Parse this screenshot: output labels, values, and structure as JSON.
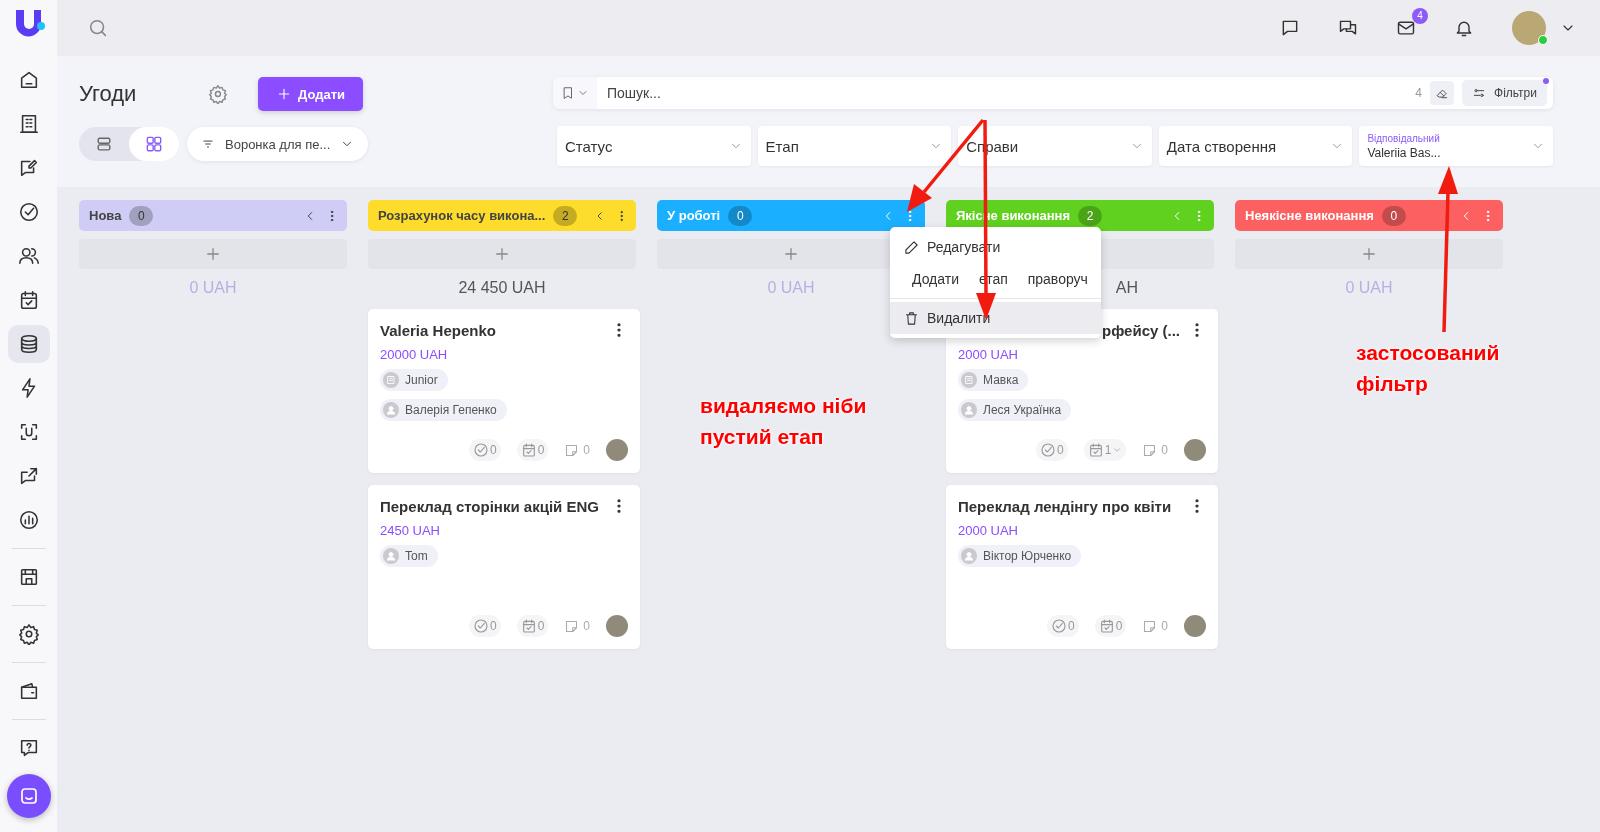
{
  "sidebar": {
    "nav_items": [
      {
        "selected": false
      },
      {
        "selected": false
      },
      {
        "selected": false
      },
      {
        "selected": false
      },
      {
        "selected": false
      },
      {
        "selected": false
      },
      {
        "selected": true
      },
      {
        "selected": false
      },
      {
        "selected": false
      },
      {
        "selected": false
      },
      {
        "selected": false
      },
      {
        "selected": false
      },
      {
        "selected": false
      },
      {
        "selected": false
      },
      {
        "selected": false
      }
    ]
  },
  "top_bar": {
    "mail_badge": "4",
    "avatar_online": true
  },
  "header": {
    "title": "Угоди",
    "add_button": "Додати",
    "view_toggle": [
      {
        "selected": false
      },
      {
        "selected": true
      }
    ],
    "funnel_select": "Воронка для пе...",
    "search": {
      "placeholder": "Пошук...",
      "count": "4"
    },
    "filters_button": "Фільтри",
    "filters_active": true,
    "filters": [
      {
        "kind": "empty",
        "label": "Статус"
      },
      {
        "kind": "empty",
        "label": "Етап"
      },
      {
        "kind": "empty",
        "label": "Справи"
      },
      {
        "kind": "empty",
        "label": "Дата створення"
      },
      {
        "kind": "applied",
        "label": "Відповідальний",
        "value": "Valeriia Bas..."
      }
    ]
  },
  "columns": [
    {
      "name": "Нова",
      "count": "0",
      "color": "#cfcdf5",
      "total": "0 UAH",
      "total_partly_hidden": false
    },
    {
      "name": "Розрахунок часу викона...",
      "count": "2",
      "color": "#fddc2c",
      "total": "24 450 UAH",
      "total_partly_hidden": false,
      "cards": [
        {
          "title": "Valeria Hepenko",
          "partly_hidden": false,
          "amount": "20000 UAH",
          "tags": [
            {
              "kind": "company",
              "text": "Junior"
            },
            {
              "kind": "person",
              "text": "Валерія Гепенко"
            }
          ],
          "tasks": "0",
          "events": "0",
          "events_caret": false,
          "notes": "0"
        },
        {
          "title": "Переклад сторінки акцій ENG",
          "partly_hidden": false,
          "amount": "2450 UAH",
          "tags": [
            {
              "kind": "person",
              "text": "Tom"
            }
          ],
          "tasks": "0",
          "events": "0",
          "events_caret": false,
          "notes": "0"
        }
      ]
    },
    {
      "name": "У роботі",
      "count": "0",
      "color": "#1ab0ff",
      "total": "0 UAH",
      "total_partly_hidden": false
    },
    {
      "name": "Якісне виконання",
      "count": "2",
      "color": "#61d11f",
      "total": "AH",
      "total_partly_hidden": true,
      "cards": [
        {
          "title": "рфейсу (...",
          "partly_hidden": true,
          "amount": "2000 UAH",
          "tags": [
            {
              "kind": "company",
              "text": "Мавка"
            },
            {
              "kind": "person",
              "text": "Леся Українка"
            }
          ],
          "tasks": "0",
          "events": "1",
          "events_caret": true,
          "notes": "0"
        },
        {
          "title": "Переклад лендінгу про квіти",
          "partly_hidden": false,
          "amount": "2000 UAH",
          "tags": [
            {
              "kind": "person",
              "text": "Віктор Юрченко"
            }
          ],
          "tasks": "0",
          "events": "0",
          "events_caret": false,
          "notes": "0"
        }
      ]
    },
    {
      "name": "Неякісне виконання",
      "count": "0",
      "color": "#fc6060",
      "total": "0 UAH",
      "total_partly_hidden": false
    }
  ],
  "context_menu": {
    "items": [
      {
        "kind": "edit",
        "label": "Редагувати",
        "hovered": false
      },
      {
        "kind": "add",
        "label": "Додати етап праворуч",
        "hovered": false
      },
      {
        "kind": "delete",
        "label": "Видалити",
        "hovered": true
      }
    ]
  },
  "annotations": [
    {
      "text": "видаляємо ніби пустий етап"
    },
    {
      "text": "застосований фільтр"
    }
  ]
}
